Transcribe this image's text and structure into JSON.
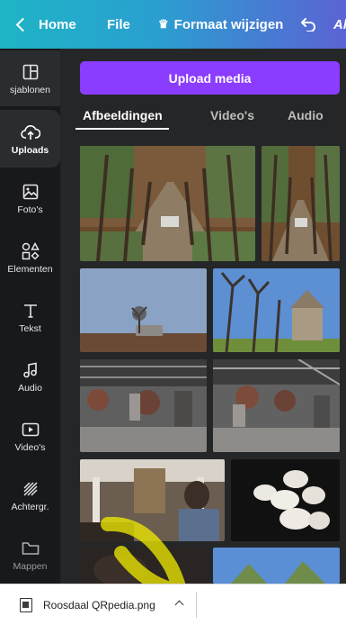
{
  "topbar": {
    "home_label": "Home",
    "file_label": "File",
    "resize_label": "Formaat wijzigen",
    "crown_icon": "crown-icon",
    "overflow_text": "Al"
  },
  "sidebar": {
    "items": [
      {
        "label": "sjablonen",
        "icon": "template-icon"
      },
      {
        "label": "Uploads",
        "icon": "cloud-upload-icon"
      },
      {
        "label": "Foto's",
        "icon": "photo-icon"
      },
      {
        "label": "Elementen",
        "icon": "shapes-icon"
      },
      {
        "label": "Tekst",
        "icon": "text-icon"
      },
      {
        "label": "Audio",
        "icon": "music-note-icon"
      },
      {
        "label": "Video's",
        "icon": "play-icon"
      },
      {
        "label": "Achtergr.",
        "icon": "background-pattern-icon"
      },
      {
        "label": "Mappen",
        "icon": "folder-icon"
      }
    ]
  },
  "panel": {
    "upload_button": "Upload media",
    "tabs": [
      "Afbeeldingen",
      "Video's",
      "Audio"
    ],
    "active_tab": "Afbeeldingen"
  },
  "downloads": {
    "file_name": "Roosdaal QRpedia.png"
  },
  "colors": {
    "brand_purple": "#8b3dff",
    "sidebar_bg": "#18191b",
    "panel_bg": "#252627",
    "highlight": "#f2ee00"
  }
}
